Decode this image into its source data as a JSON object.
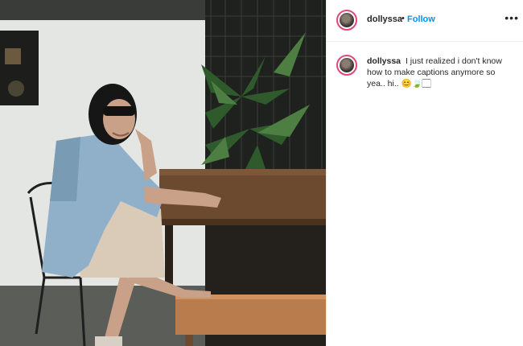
{
  "post": {
    "username": "dollyssa",
    "separator": "•",
    "follow_label": "Follow",
    "more_icon": "more-options-icon",
    "caption": {
      "username": "dollyssa",
      "text": "I just realized i don't know how to make captions anymore so yea.. hi.. 😊🍃🏻"
    }
  },
  "photo": {
    "description_icon": "post-photo"
  },
  "colors": {
    "accent": "#0095f6",
    "story_ring": "#e0487c",
    "text": "#262626"
  }
}
